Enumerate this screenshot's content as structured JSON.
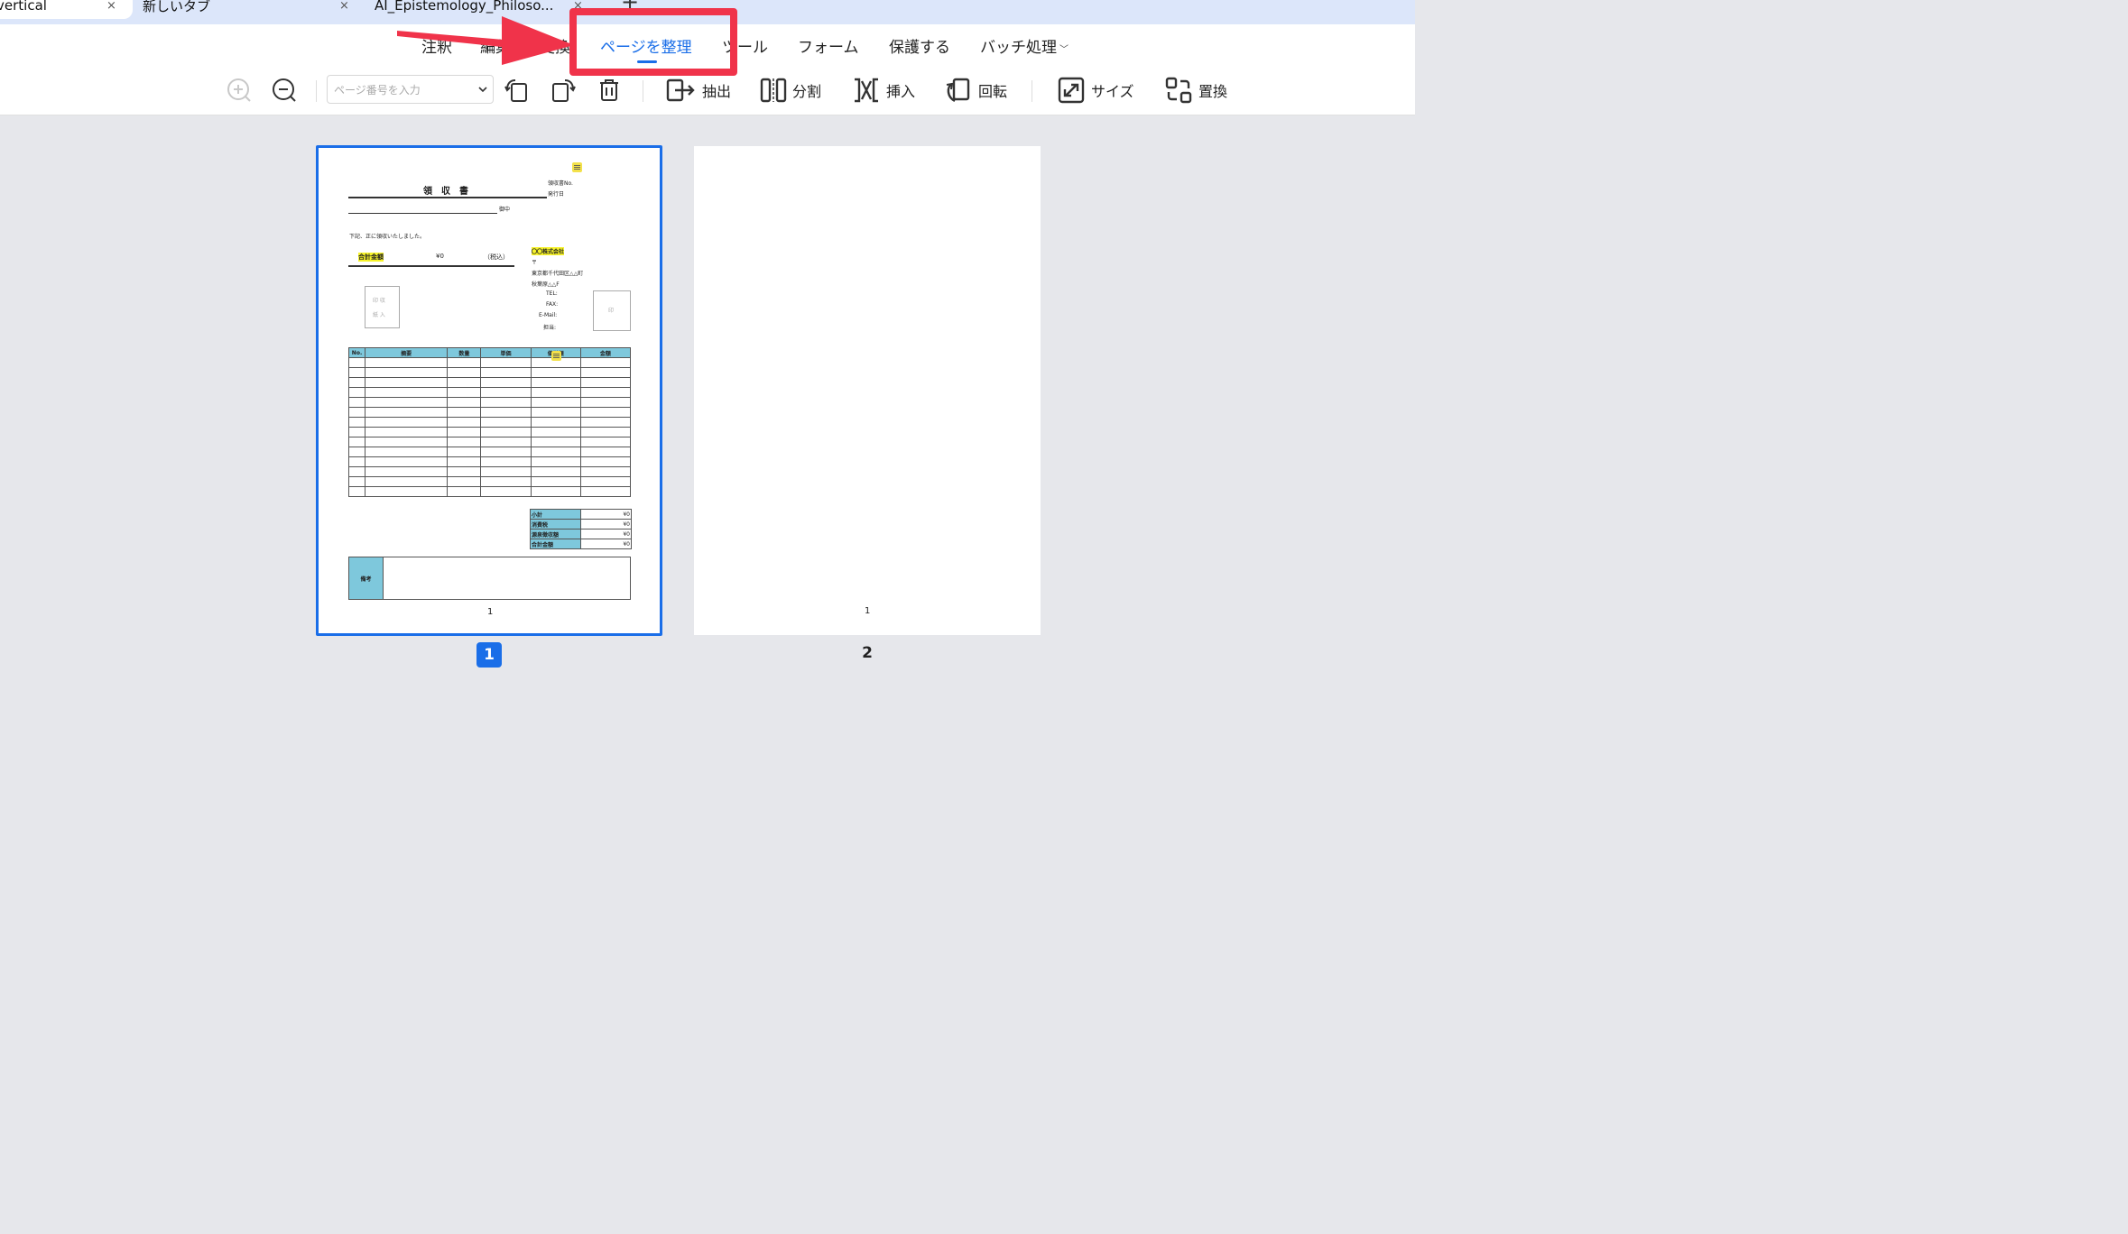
{
  "tabs": [
    {
      "title": "vertical",
      "close": "×"
    },
    {
      "title": "新しいタブ",
      "close": "×"
    },
    {
      "title": "AI_Epistemology_Philoso...",
      "close": "×"
    }
  ],
  "new_tab": "+",
  "menu": {
    "items": [
      "注釈",
      "編集",
      "変換",
      "ページを整理",
      "ツール",
      "フォーム",
      "保護する",
      "バッチ処理"
    ],
    "active": "ページを整理",
    "batch_chevron": "﹀"
  },
  "toolbar": {
    "page_input_placeholder": "ページ番号を入力",
    "extract": "抽出",
    "split": "分割",
    "insert": "挿入",
    "rotate": "回転",
    "size": "サイズ",
    "replace": "置換"
  },
  "pages": [
    {
      "label": "1",
      "inner_page_number": "1",
      "selected": true
    },
    {
      "label": "2",
      "inner_page_number": "1",
      "selected": false
    }
  ],
  "receipt": {
    "title": "領　収　書",
    "receipt_no_label": "領収書No.",
    "issue_date_label": "発行日",
    "recipient_suffix": "御中",
    "received_text": "下記、正に領収いたしました。",
    "total_label": "合計金額",
    "total_value": "¥0",
    "tax_note": "（税込）",
    "company": "〇〇株式会社",
    "postal": "〒",
    "address1": "東京都千代田区△△町",
    "address2": "秋葉原△△F",
    "tel": "TEL:",
    "fax": "FAX:",
    "email": "E-Mail:",
    "person": "担当:",
    "stamp_line1": "印 収",
    "stamp_line2": "紙 入",
    "seal": "印",
    "columns": [
      "No.",
      "摘要",
      "数量",
      "単価",
      "値引額",
      "金額"
    ],
    "summary": [
      {
        "label": "小計",
        "value": "¥0"
      },
      {
        "label": "消費税",
        "value": "¥0"
      },
      {
        "label": "源泉徴収額",
        "value": "¥0"
      },
      {
        "label": "合計金額",
        "value": "¥0"
      }
    ],
    "remarks_label": "備考"
  },
  "colors": {
    "accent": "#1a6ee8",
    "annotation": "#f0334a",
    "table_header": "#7ec8dc",
    "highlight": "#f7f32a"
  }
}
